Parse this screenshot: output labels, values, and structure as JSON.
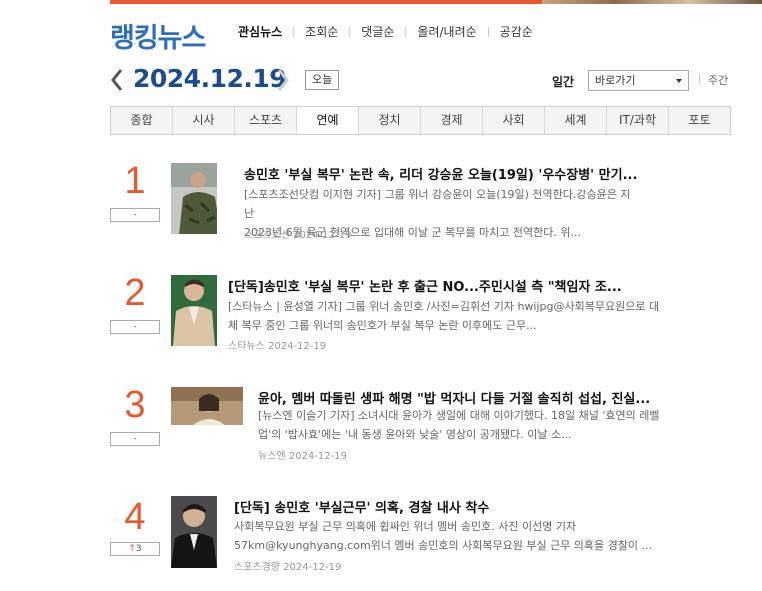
{
  "header": {
    "brand": "랭킹뉴스",
    "nav": [
      "관심뉴스",
      "조회순",
      "댓글순",
      "올려/내려순",
      "공감순"
    ]
  },
  "datebar": {
    "date": "2024.12.19",
    "today_label": "오늘",
    "ilgan_label": "일간",
    "goto_label": "바로가기",
    "weekly_label": "주간"
  },
  "tabs": [
    "종합",
    "시사",
    "스포츠",
    "연예",
    "정치",
    "경제",
    "사회",
    "세계",
    "IT/과학",
    "포토"
  ],
  "active_tab": "연예",
  "colors": {
    "accent": "#e9572c",
    "brand": "#2d6fb7",
    "date": "#1a4c8f"
  },
  "items": [
    {
      "rank": "1",
      "change": "-",
      "title": "송민호 '부실 복무' 논란 속, 리더 강승윤 오늘(19일) '우수장병' 만기...",
      "summary_line1": "[스포츠조선닷컴 이지현 기자] 그룹 위너 강승윤이 오늘(19일) 전역한다.강승윤은 지난",
      "summary_line2": "2023년 6월 육군 현역으로 입대해 이날 군 복무를 마치고 전역한다. 위...",
      "source": "스포츠조선",
      "date": "2024-12-19"
    },
    {
      "rank": "2",
      "change": "-",
      "title": "[단독]송민호 '부실 복무' 논란 후 출근 NO...주민시설 측 \"책임자 조...",
      "summary_line1": "[스타뉴스 | 윤성열 기자] 그룹 위너 송민호 /사진=김휘선 기자 hwijpg@사회복무요원으로 대",
      "summary_line2": "체 복무 중인 그룹 위너의 송민호가 부실 복무 논란 이후에도 근무...",
      "source": "스타뉴스",
      "date": "2024-12-19"
    },
    {
      "rank": "3",
      "change": "-",
      "title": "윤아, 멤버 따돌린 생파 해명 \"밥 먹자니 다들 거절 솔직히 섭섭, 진실...",
      "summary_line1": "[뉴스엔 이슬기 기자] 소녀시대 윤아가 생일에 대해 이야기했다. 18일 채널 '효연의 레벨",
      "summary_line2": "업'의 '밥사효'에는 '내 동생 윤아와 낮술' 영상이 공개됐다. 이날 소...",
      "source": "뉴스엔",
      "date": "2024-12-19"
    },
    {
      "rank": "4",
      "change": "3",
      "title": "[단독] 송민호 '부실근무' 의혹, 경찰 내사 착수",
      "summary_line1": "사회복무요원 부실 근무 의혹에 휩싸인 위너 멤버 송민호. 사진 이선명 기자",
      "summary_line2": "57km@kyunghyang.com위너 멤버 송민호의 사회복무요원 부실 근무 의혹을 경찰이 ...",
      "source": "스포츠경향",
      "date": "2024-12-19"
    }
  ]
}
